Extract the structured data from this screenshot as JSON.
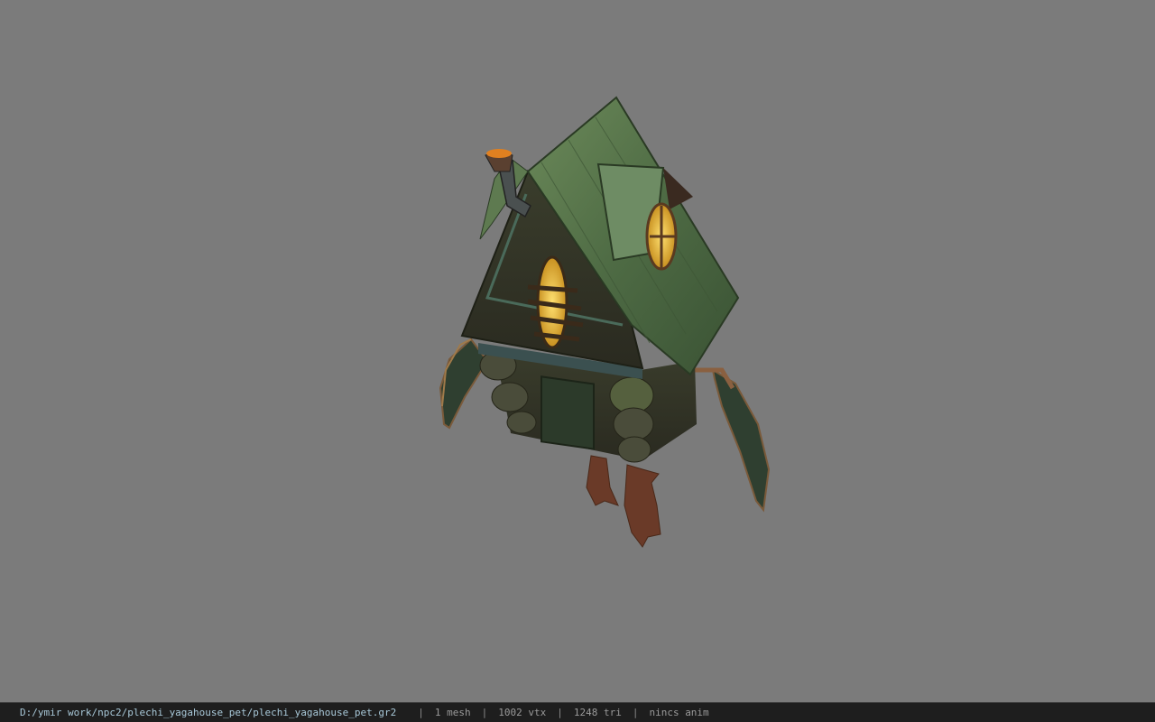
{
  "viewer": {
    "background_color": "#7b7b7b",
    "model_icon": "yaga-house-model"
  },
  "status_bar": {
    "file_path": "D:/ymir work/npc2/plechi_yagahouse_pet/plechi_yagahouse_pet.gr2",
    "separator": "|",
    "mesh_count": "1 mesh",
    "vertex_count": "1002 vtx",
    "triangle_count": "1248 tri",
    "animation": "nincs anim"
  }
}
